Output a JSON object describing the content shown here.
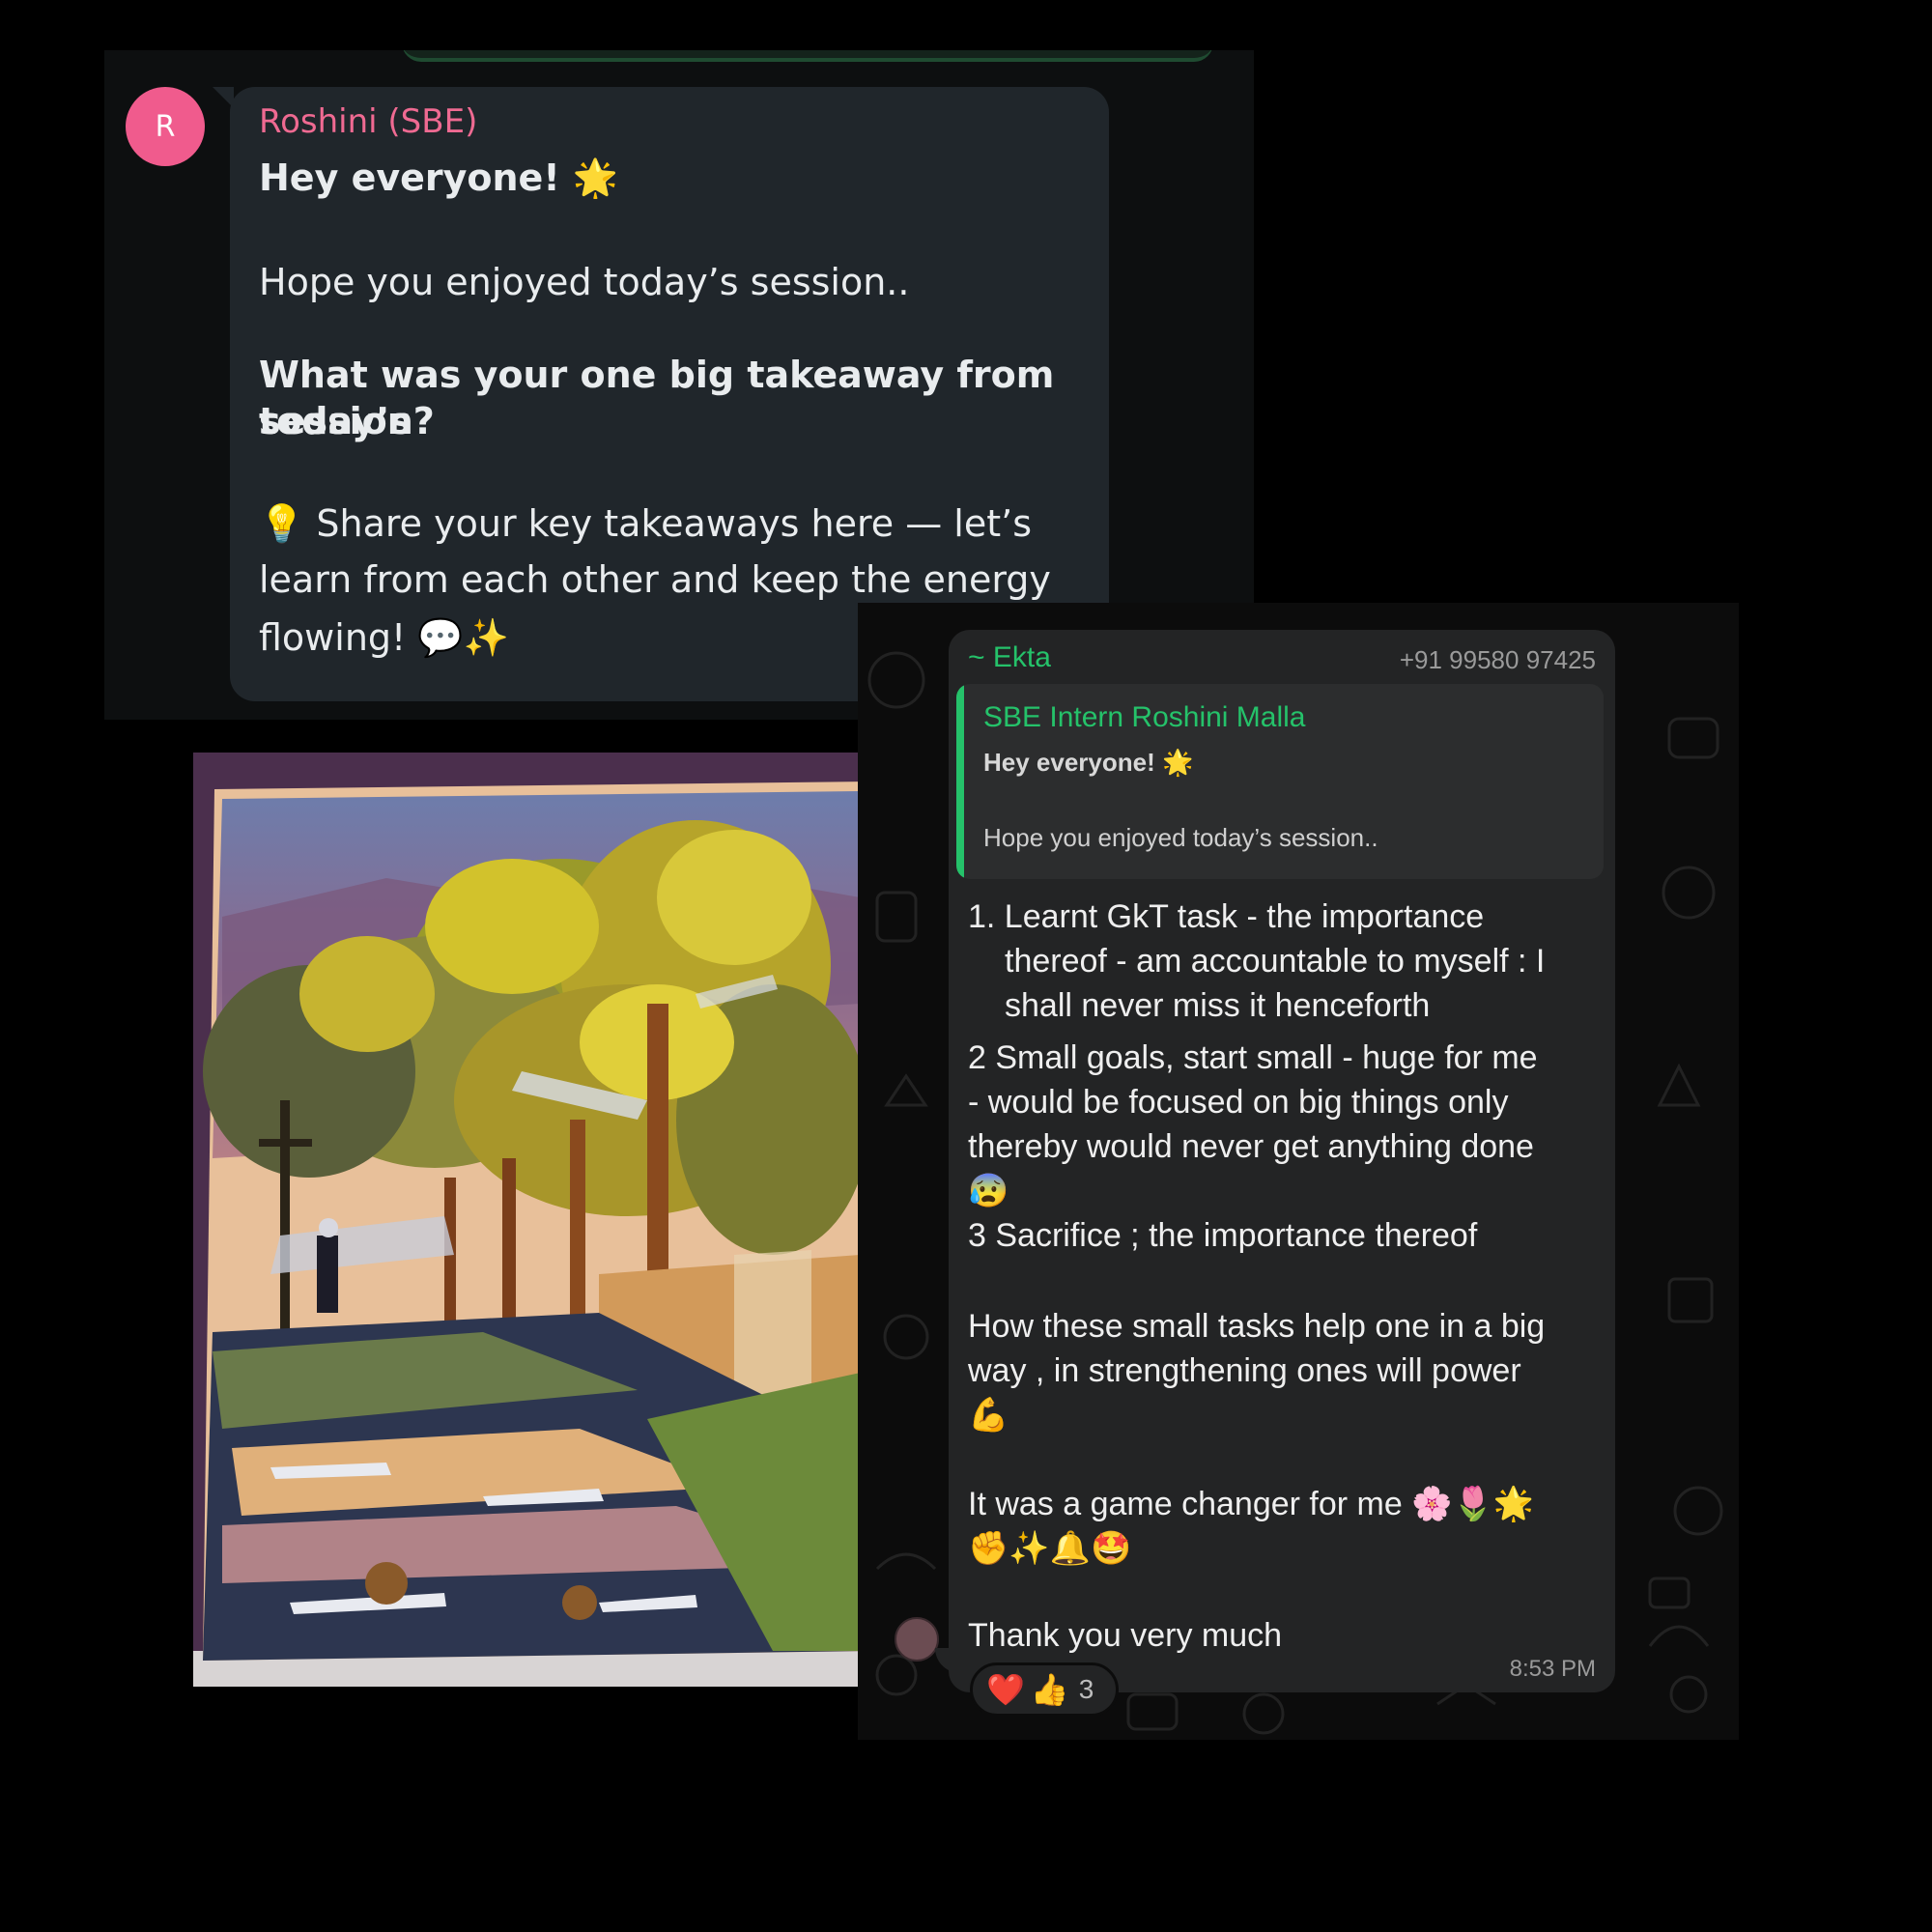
{
  "chat_top": {
    "avatar_letter": "R",
    "sender": "Roshini (SBE)",
    "greeting": "Hey everyone! 🌟",
    "line1": "Hope you enjoyed today’s session..",
    "question_line1": "What was your one big takeaway from today’s",
    "question_line2": "session?",
    "share_line1": "💡 Share your key takeaways here — let’s",
    "share_line2": "learn from each other and keep the energy",
    "share_line3": "flowing! 💬✨"
  },
  "reply": {
    "sender": "~ Ekta",
    "phone": "+91 99580 97425",
    "quote": {
      "name": "SBE Intern Roshini Malla",
      "line1": "Hey everyone! 🌟",
      "line2": "Hope you enjoyed today’s session.."
    },
    "item1_line1": "1. Learnt GkT task - the importance",
    "item1_line2": "thereof - am accountable to myself : I",
    "item1_line3": "shall never miss it henceforth",
    "item2_line1": "2 Small goals, start small - huge for me",
    "item2_line2": "- would be focused on big things only",
    "item2_line3": "thereby would never get anything done",
    "item2_emoji": "😰",
    "item3": "3 Sacrifice ; the importance thereof",
    "para1_line1": "How these small tasks help one in a big",
    "para1_line2": "way , in strengthening ones will power",
    "para1_emoji": "💪",
    "para2_line1": "It was a game changer for me 🌸🌷🌟",
    "para2_line2": "✊✨🔔🤩",
    "thanks": "Thank you very much",
    "time": "8:53 PM",
    "reaction_heart": "❤️",
    "reaction_thumbs": "👍",
    "reaction_count": "3"
  },
  "colors": {
    "accent_green": "#25c26a",
    "sender_pink": "#ef6a92",
    "avatar_pink": "#f05b8d"
  }
}
